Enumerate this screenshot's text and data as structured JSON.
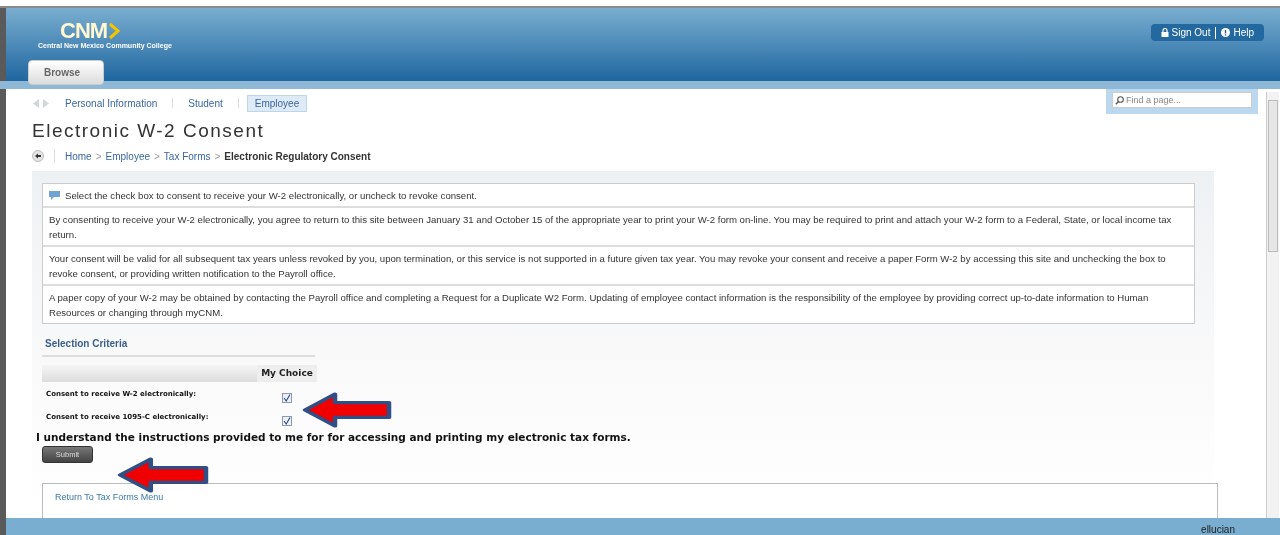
{
  "header": {
    "logo": "CNM",
    "logo_subtitle": "Central New Mexico Community College",
    "browse_button": "Browse",
    "top_links": [
      "Sign Out",
      "Help"
    ]
  },
  "nav_tabs": [
    {
      "label": "Personal Information",
      "selected": false
    },
    {
      "label": "Student",
      "selected": false
    },
    {
      "label": "Employee",
      "selected": true
    }
  ],
  "search": {
    "placeholder": "Find a page..."
  },
  "page_title": "Electronic W-2 Consent",
  "breadcrumb": {
    "links": [
      "Home",
      "Employee",
      "Tax Forms"
    ],
    "separator": ">",
    "current": "Electronic Regulatory Consent"
  },
  "info_notes": [
    {
      "kind": "tip",
      "text": "Select the check box to consent to receive your W-2 electronically, or uncheck to revoke consent."
    },
    {
      "kind": "note",
      "text": "By consenting to receive your W-2 electronically, you agree to return to this site between January 31 and October 15 of the appropriate year to print your W-2 form on-line. You may be required to print and attach your W-2 form to a Federal, State, or local income tax return."
    },
    {
      "kind": "note",
      "text": "Your consent will be valid for all subsequent tax years unless revoked by you, upon termination, or this service is not supported in a future given tax year. You may revoke your consent and receive a paper Form W-2 by accessing this site and unchecking the box to revoke consent, or providing written notification to the Payroll office."
    },
    {
      "kind": "note",
      "text": "A paper copy of your W-2 may be obtained by contacting the Payroll office and completing a Request for a Duplicate W2 Form. Updating of employee contact information is the responsibility of the employee by providing correct up-to-date information to Human Resources or changing through myCNM."
    }
  ],
  "selection_criteria": {
    "title": "Selection Criteria",
    "column_header": "My Choice",
    "rows": [
      {
        "label": "Consent to receive W-2 electronically:",
        "checked": true
      },
      {
        "label": "Consent to receive 1095-C electronically:",
        "checked": true
      }
    ]
  },
  "acknowledgement": "I understand the instructions provided to me for for accessing and printing my electronic tax forms.",
  "submit_button": "Submit",
  "return_link": "Return To Tax Forms Menu",
  "footer": {
    "brand": "ellucian"
  }
}
